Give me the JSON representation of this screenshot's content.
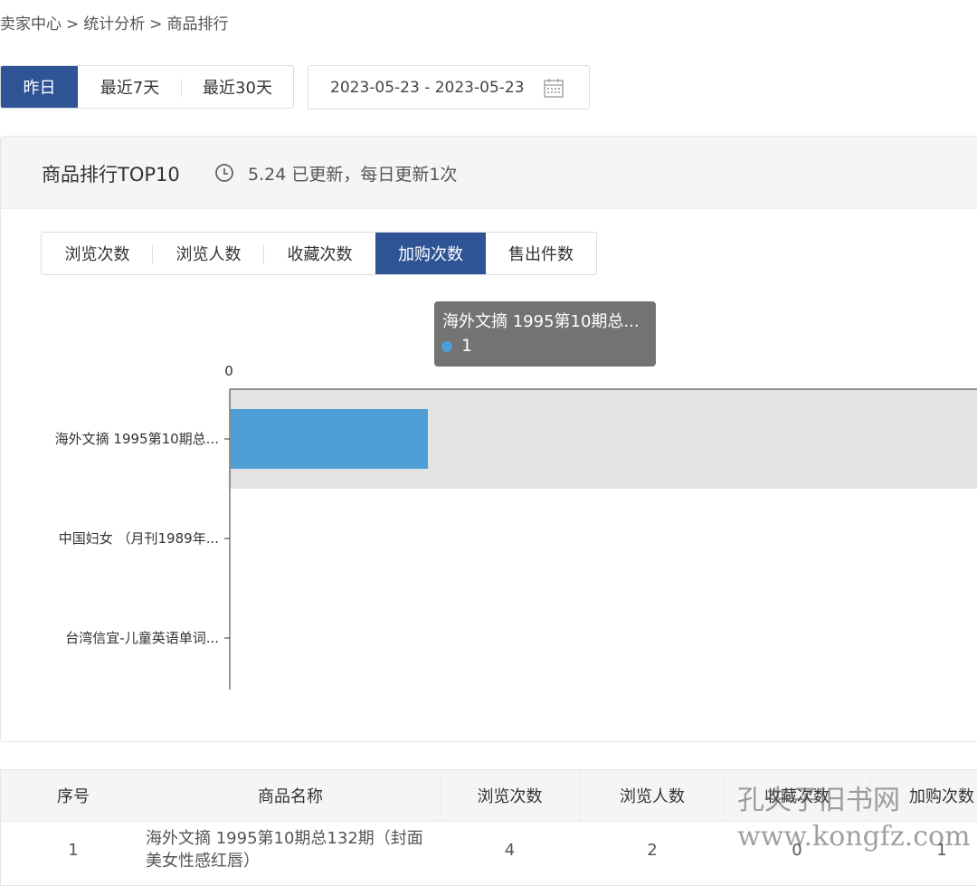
{
  "breadcrumb": [
    "卖家中心",
    ">",
    "统计分析",
    ">",
    "商品排行"
  ],
  "range_buttons": [
    "昨日",
    "最近7天",
    "最近30天"
  ],
  "date_range": "2023-05-23 - 2023-05-23",
  "card": {
    "title": "商品排行TOP10",
    "update_text": "5.24 已更新，每日更新1次"
  },
  "metric_tabs": [
    "浏览次数",
    "浏览人数",
    "收藏次数",
    "加购次数",
    "售出件数"
  ],
  "active_metric": "加购次数",
  "chart_data": {
    "type": "bar",
    "orientation": "horizontal",
    "categories": [
      "海外文摘 1995第10期总...",
      "中国妇女 （月刊1989年...",
      "台湾信宜-儿童英语单词..."
    ],
    "values": [
      1,
      0,
      0
    ],
    "x_axis_ticks": [
      "0"
    ],
    "highlighted_index": 0,
    "bar_color": "#4f9fd6",
    "tooltip": {
      "title": "海外文摘 1995第10期总...",
      "value": "1"
    }
  },
  "table": {
    "headers": [
      "序号",
      "商品名称",
      "浏览次数",
      "浏览人数",
      "收藏次数",
      "加购次数"
    ],
    "rows": [
      {
        "index": "1",
        "name": "海外文摘 1995第10期总132期（封面美女性感红唇）",
        "views": "4",
        "visitors": "2",
        "favorites": "0",
        "cart_adds": "1"
      }
    ]
  },
  "watermark": "孔夫子旧书网 www.kongfz.com"
}
